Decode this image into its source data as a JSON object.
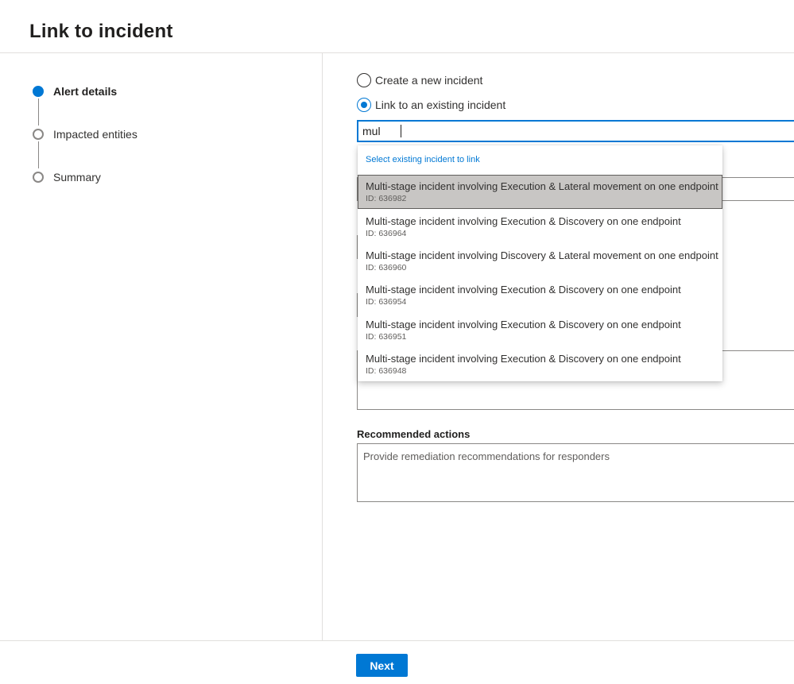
{
  "page": {
    "title": "Link to incident"
  },
  "steps": [
    {
      "label": "Alert details",
      "active": true
    },
    {
      "label": "Impacted entities",
      "active": false
    },
    {
      "label": "Summary",
      "active": false
    }
  ],
  "incident_choice": {
    "create_new_label": "Create a new incident",
    "link_existing_label": "Link to an existing incident",
    "selected": "link_existing"
  },
  "search": {
    "value": "mul"
  },
  "dropdown": {
    "header": "Select existing incident to link",
    "items": [
      {
        "title": "Multi-stage incident involving Execution & Lateral movement on one endpoint",
        "id": "ID: 636982",
        "highlighted": true
      },
      {
        "title": "Multi-stage incident involving Execution & Discovery on one endpoint",
        "id": "ID: 636964",
        "highlighted": false
      },
      {
        "title": "Multi-stage incident involving Discovery & Lateral movement on one endpoint",
        "id": "ID: 636960",
        "highlighted": false
      },
      {
        "title": "Multi-stage incident involving Execution & Discovery on one endpoint",
        "id": "ID: 636954",
        "highlighted": false
      },
      {
        "title": "Multi-stage incident involving Execution & Discovery on one endpoint",
        "id": "ID: 636951",
        "highlighted": false
      },
      {
        "title": "Multi-stage incident involving Execution & Discovery on one endpoint",
        "id": "ID: 636948",
        "highlighted": false
      }
    ]
  },
  "recommended_actions": {
    "label": "Recommended actions",
    "placeholder": "Provide remediation recommendations for responders"
  },
  "footer": {
    "next_label": "Next"
  },
  "colors": {
    "accent": "#0078d4",
    "highlight": "#c8c6c4"
  }
}
